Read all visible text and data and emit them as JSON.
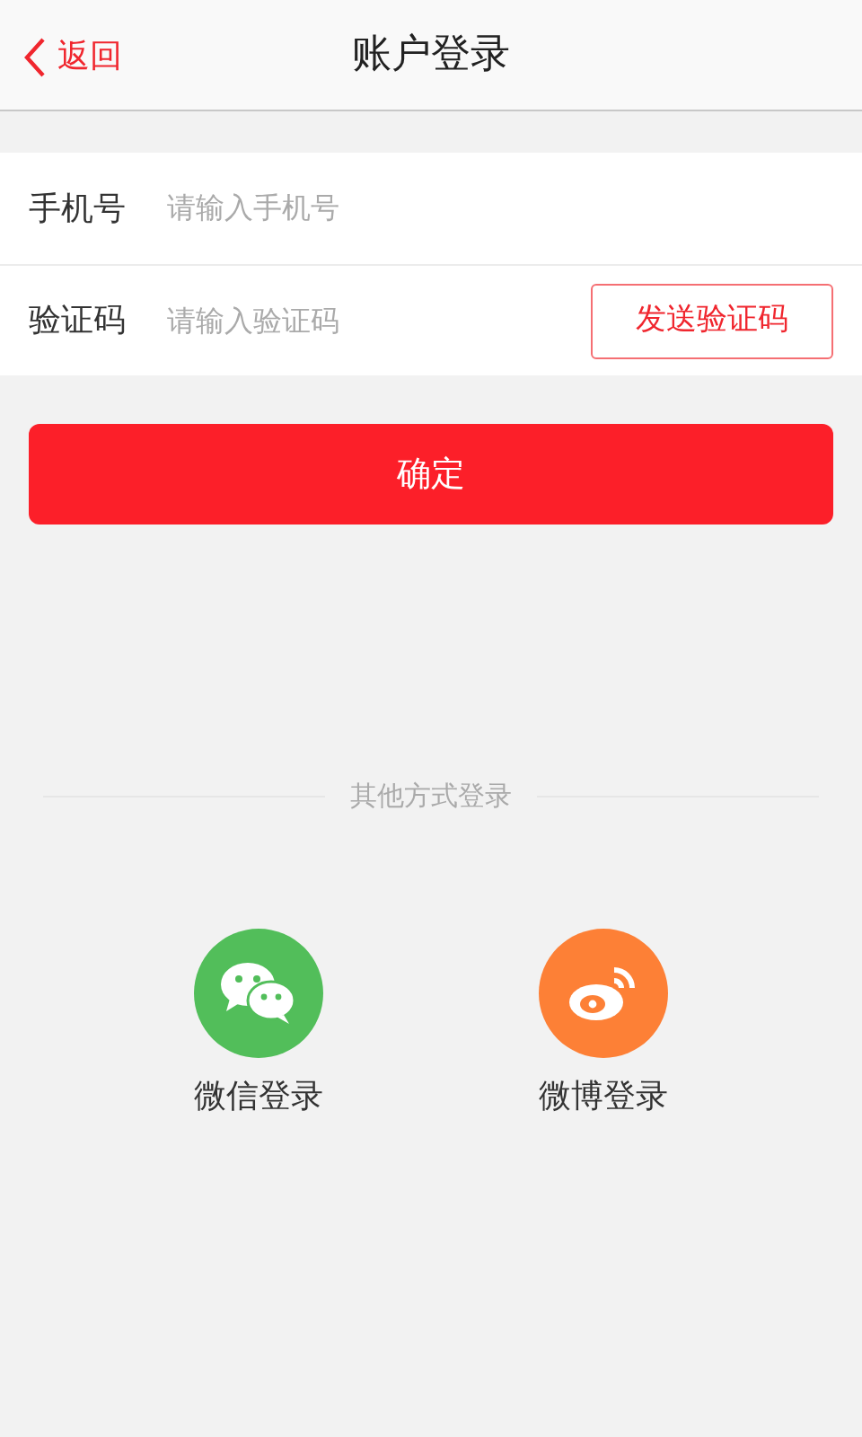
{
  "header": {
    "back": "返回",
    "title": "账户登录"
  },
  "fields": [
    {
      "kind": "phone",
      "label": "手机号",
      "placeholder": "请输入手机号"
    },
    {
      "kind": "code",
      "label": "验证码",
      "placeholder": "请输入验证码",
      "action": "发送验证码"
    }
  ],
  "submit": "确定",
  "other_login": {
    "title": "其他方式登录",
    "options": [
      {
        "kind": "wechat",
        "label": "微信登录",
        "color": "#52be5a"
      },
      {
        "kind": "weibo",
        "label": "微博登录",
        "color": "#fd8036"
      }
    ]
  }
}
